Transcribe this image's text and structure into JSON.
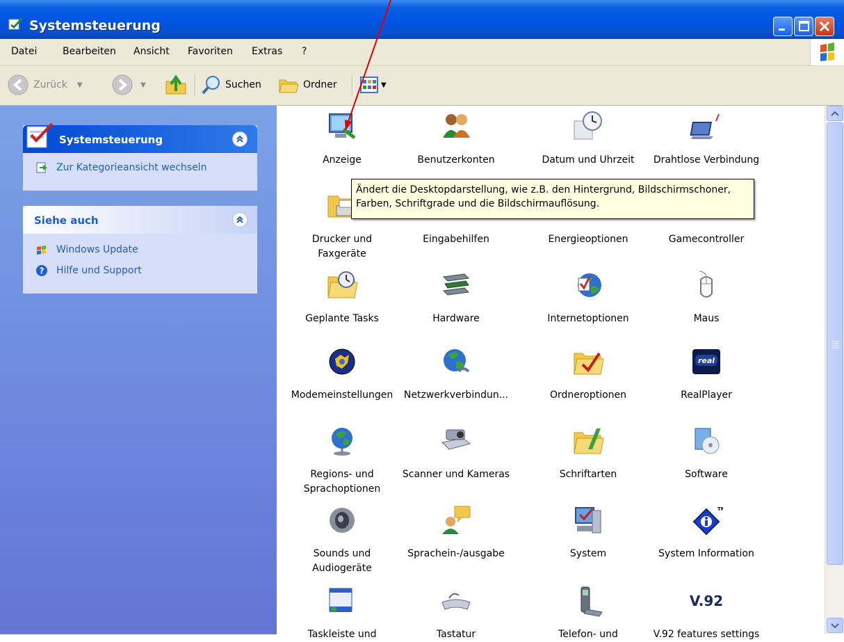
{
  "window": {
    "title": "Systemsteuerung"
  },
  "menu": {
    "items": [
      {
        "label": "Datei"
      },
      {
        "label": "Bearbeiten"
      },
      {
        "label": "Ansicht"
      },
      {
        "label": "Favoriten"
      },
      {
        "label": "Extras"
      },
      {
        "label": "?"
      }
    ]
  },
  "toolbar": {
    "back_label": "Zurück",
    "search_label": "Suchen",
    "folders_label": "Ordner"
  },
  "sidebar": {
    "panel1": {
      "title": "Systemsteuerung",
      "items": [
        {
          "label": "Zur Kategorieansicht wechseln"
        }
      ]
    },
    "panel2": {
      "title": "Siehe auch",
      "items": [
        {
          "label": "Windows Update"
        },
        {
          "label": "Hilfe und Support"
        }
      ]
    }
  },
  "items": [
    {
      "label": "Anzeige",
      "icon": "display-icon"
    },
    {
      "label": "Benutzerkonten",
      "icon": "users-icon"
    },
    {
      "label": "Datum und Uhrzeit",
      "icon": "clock-icon"
    },
    {
      "label": "Drahtlose Verbindung",
      "icon": "wireless-icon"
    },
    {
      "label": "Drucker und\nFaxgeräte",
      "icon": "printer-icon"
    },
    {
      "label": "Eingabehilfen",
      "icon": "accessibility-icon"
    },
    {
      "label": "Energieoptionen",
      "icon": "power-icon"
    },
    {
      "label": "Gamecontroller",
      "icon": "gamepad-icon"
    },
    {
      "label": "Geplante Tasks",
      "icon": "tasks-folder-icon"
    },
    {
      "label": "Hardware",
      "icon": "hardware-icon"
    },
    {
      "label": "Internetoptionen",
      "icon": "internet-globe-icon"
    },
    {
      "label": "Maus",
      "icon": "mouse-icon"
    },
    {
      "label": "Modemeinstellungen",
      "icon": "modem-icon"
    },
    {
      "label": "Netzwerkverbindun...",
      "icon": "network-globe-icon"
    },
    {
      "label": "Ordneroptionen",
      "icon": "folder-options-icon"
    },
    {
      "label": "RealPlayer",
      "icon": "realplayer-icon"
    },
    {
      "label": "Regions- und\nSprachoptionen",
      "icon": "globe-stand-icon"
    },
    {
      "label": "Scanner und Kameras",
      "icon": "scanner-icon"
    },
    {
      "label": "Schriftarten",
      "icon": "fonts-folder-icon"
    },
    {
      "label": "Software",
      "icon": "software-icon"
    },
    {
      "label": "Sounds und\nAudiogeräte",
      "icon": "speaker-icon"
    },
    {
      "label": "Sprachein-/ausgabe",
      "icon": "speech-icon"
    },
    {
      "label": "System",
      "icon": "system-icon"
    },
    {
      "label": "System Information",
      "icon": "info-icon"
    },
    {
      "label": "Taskleiste und",
      "icon": "taskbar-icon"
    },
    {
      "label": "Tastatur",
      "icon": "keyboard-icon"
    },
    {
      "label": "Telefon- und",
      "icon": "phone-icon"
    },
    {
      "label": "V.92 features settings",
      "icon": "v92-icon",
      "icon_text": "V.92"
    }
  ],
  "tooltip": {
    "line1": "Ändert die Desktopdarstellung, wie z.B. den Hintergrund, Bildschirmschoner,",
    "line2": "Farben, Schriftgrade und die Bildschirmauflösung."
  },
  "colors": {
    "titlebar": "#0054e3",
    "sidebar": "#6e8fe0",
    "panel": "#d6dff7",
    "link": "#215dc6",
    "annotation_arrow": "#e00000"
  }
}
